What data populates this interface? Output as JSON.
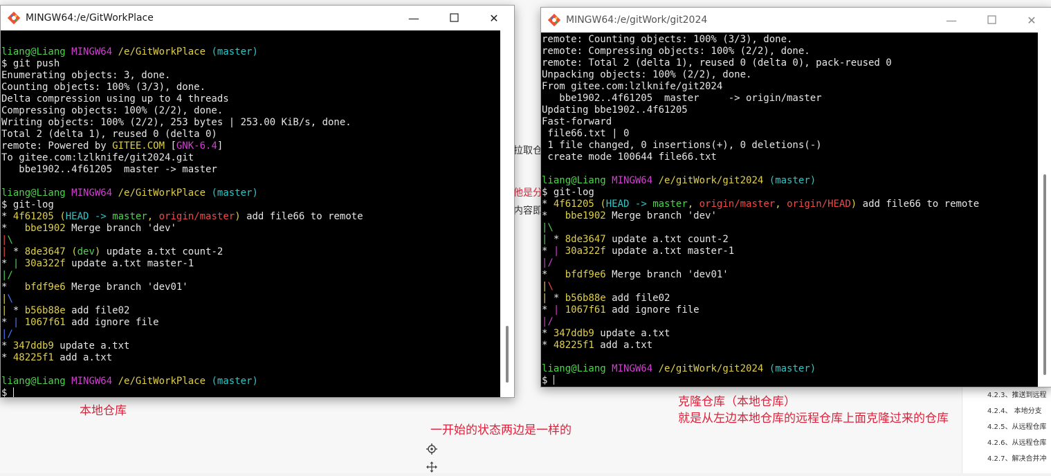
{
  "background": {
    "snippets": [
      {
        "text": "拉取仓",
        "color": "dark"
      },
      {
        "text": "他是分",
        "color": "red"
      },
      {
        "text": "内容即",
        "color": "dark"
      },
      {
        "text": "一开始的状态两边是一样的",
        "color": "red"
      }
    ],
    "toc": [
      "4.2.3、推送到远程",
      "4.2.4、 本地分支",
      "4.2.5、从远程仓库",
      "4.2.6、从远程仓库",
      "4.2.7、解决合并冲"
    ],
    "annotations": {
      "left": "本地仓库",
      "right_line1": "克隆仓库（本地仓库）",
      "right_line2": "就是从左边本地仓库的远程仓库上面克隆过来的仓库",
      "middle": "一开始的状态两边是一样的"
    }
  },
  "windows": {
    "left": {
      "title": "MINGW64:/e/GitWorkPlace",
      "lines": [
        [],
        [
          [
            "g",
            "liang@Liang"
          ],
          [
            "w",
            " "
          ],
          [
            "m",
            "MINGW64"
          ],
          [
            "w",
            " "
          ],
          [
            "y",
            "/e/GitWorkPlace"
          ],
          [
            "w",
            " "
          ],
          [
            "c",
            "(master)"
          ]
        ],
        [
          [
            "w",
            "$ git push"
          ]
        ],
        [
          [
            "w",
            "Enumerating objects: 3, done."
          ]
        ],
        [
          [
            "w",
            "Counting objects: 100% (3/3), done."
          ]
        ],
        [
          [
            "w",
            "Delta compression using up to 4 threads"
          ]
        ],
        [
          [
            "w",
            "Compressing objects: 100% (2/2), done."
          ]
        ],
        [
          [
            "w",
            "Writing objects: 100% (2/2), 253 bytes | 253.00 KiB/s, done."
          ]
        ],
        [
          [
            "w",
            "Total 2 (delta 1), reused 0 (delta 0)"
          ]
        ],
        [
          [
            "w",
            "remote: Powered by "
          ],
          [
            "y",
            "GITEE.COM"
          ],
          [
            "w",
            " ["
          ],
          [
            "m",
            "GNK-6.4"
          ],
          [
            "w",
            "]"
          ]
        ],
        [
          [
            "w",
            "To gitee.com:lzlknife/git2024.git"
          ]
        ],
        [
          [
            "w",
            "   bbe1902..4f61205  master -> master"
          ]
        ],
        [],
        [
          [
            "g",
            "liang@Liang"
          ],
          [
            "w",
            " "
          ],
          [
            "m",
            "MINGW64"
          ],
          [
            "w",
            " "
          ],
          [
            "y",
            "/e/GitWorkPlace"
          ],
          [
            "w",
            " "
          ],
          [
            "c",
            "(master)"
          ]
        ],
        [
          [
            "w",
            "$ git-log"
          ]
        ],
        [
          [
            "w",
            "* "
          ],
          [
            "y",
            "4f61205"
          ],
          [
            "w",
            " "
          ],
          [
            "y",
            "("
          ],
          [
            "c",
            "HEAD -> "
          ],
          [
            "g",
            "master"
          ],
          [
            "y",
            ", "
          ],
          [
            "r",
            "origin/master"
          ],
          [
            "y",
            ")"
          ],
          [
            "w",
            " add file66 to remote"
          ]
        ],
        [
          [
            "w",
            "*   "
          ],
          [
            "y",
            "bbe1902"
          ],
          [
            "w",
            " Merge branch 'dev'"
          ]
        ],
        [
          [
            "r",
            "|"
          ],
          [
            "g",
            "\\"
          ]
        ],
        [
          [
            "r",
            "|"
          ],
          [
            "w",
            " * "
          ],
          [
            "y",
            "8de3647"
          ],
          [
            "w",
            " "
          ],
          [
            "y",
            "("
          ],
          [
            "g",
            "dev"
          ],
          [
            "y",
            ")"
          ],
          [
            "w",
            " update a.txt count-2"
          ]
        ],
        [
          [
            "w",
            "* "
          ],
          [
            "g",
            "|"
          ],
          [
            "w",
            " "
          ],
          [
            "y",
            "30a322f"
          ],
          [
            "w",
            " update a.txt master-1"
          ]
        ],
        [
          [
            "g",
            "|/"
          ]
        ],
        [
          [
            "w",
            "*   "
          ],
          [
            "y",
            "bfdf9e6"
          ],
          [
            "w",
            " Merge branch 'dev01'"
          ]
        ],
        [
          [
            "y",
            "|"
          ],
          [
            "b",
            "\\"
          ]
        ],
        [
          [
            "y",
            "|"
          ],
          [
            "w",
            " * "
          ],
          [
            "y",
            "b56b88e"
          ],
          [
            "w",
            " add file02"
          ]
        ],
        [
          [
            "w",
            "* "
          ],
          [
            "b",
            "|"
          ],
          [
            "w",
            " "
          ],
          [
            "y",
            "1067f61"
          ],
          [
            "w",
            " add ignore file"
          ]
        ],
        [
          [
            "b",
            "|/"
          ]
        ],
        [
          [
            "w",
            "* "
          ],
          [
            "y",
            "347ddb9"
          ],
          [
            "w",
            " update a.txt"
          ]
        ],
        [
          [
            "w",
            "* "
          ],
          [
            "y",
            "48225f1"
          ],
          [
            "w",
            " add a.txt"
          ]
        ],
        [],
        [
          [
            "g",
            "liang@Liang"
          ],
          [
            "w",
            " "
          ],
          [
            "m",
            "MINGW64"
          ],
          [
            "w",
            " "
          ],
          [
            "y",
            "/e/GitWorkPlace"
          ],
          [
            "w",
            " "
          ],
          [
            "c",
            "(master)"
          ]
        ],
        [
          [
            "w",
            "$ "
          ],
          [
            "cursor",
            ""
          ]
        ]
      ]
    },
    "right": {
      "title": "MINGW64:/e/gitWork/git2024",
      "lines": [
        [
          [
            "w",
            "remote: Counting objects: 100% (3/3), done."
          ]
        ],
        [
          [
            "w",
            "remote: Compressing objects: 100% (2/2), done."
          ]
        ],
        [
          [
            "w",
            "remote: Total 2 (delta 1), reused 0 (delta 0), pack-reused 0"
          ]
        ],
        [
          [
            "w",
            "Unpacking objects: 100% (2/2), done."
          ]
        ],
        [
          [
            "w",
            "From gitee.com:lzlknife/git2024"
          ]
        ],
        [
          [
            "w",
            "   bbe1902..4f61205  master     -> origin/master"
          ]
        ],
        [
          [
            "w",
            "Updating bbe1902..4f61205"
          ]
        ],
        [
          [
            "w",
            "Fast-forward"
          ]
        ],
        [
          [
            "w",
            " file66.txt | 0"
          ]
        ],
        [
          [
            "w",
            " 1 file changed, 0 insertions(+), 0 deletions(-)"
          ]
        ],
        [
          [
            "w",
            " create mode 100644 file66.txt"
          ]
        ],
        [],
        [
          [
            "g",
            "liang@Liang"
          ],
          [
            "w",
            " "
          ],
          [
            "m",
            "MINGW64"
          ],
          [
            "w",
            " "
          ],
          [
            "y",
            "/e/gitWork/git2024"
          ],
          [
            "w",
            " "
          ],
          [
            "c",
            "(master)"
          ]
        ],
        [
          [
            "w",
            "$ git-log"
          ]
        ],
        [
          [
            "w",
            "* "
          ],
          [
            "y",
            "4f61205"
          ],
          [
            "w",
            " "
          ],
          [
            "y",
            "("
          ],
          [
            "c",
            "HEAD -> "
          ],
          [
            "g",
            "master"
          ],
          [
            "y",
            ", "
          ],
          [
            "r",
            "origin/master"
          ],
          [
            "y",
            ", "
          ],
          [
            "r",
            "origin/HEAD"
          ],
          [
            "y",
            ")"
          ],
          [
            "w",
            " add file66 to remote"
          ]
        ],
        [
          [
            "w",
            "*   "
          ],
          [
            "y",
            "bbe1902"
          ],
          [
            "w",
            " Merge branch 'dev'"
          ]
        ],
        [
          [
            "g",
            "|\\"
          ]
        ],
        [
          [
            "g",
            "|"
          ],
          [
            "w",
            " * "
          ],
          [
            "y",
            "8de3647"
          ],
          [
            "w",
            " update a.txt count-2"
          ]
        ],
        [
          [
            "w",
            "* "
          ],
          [
            "m",
            "|"
          ],
          [
            "w",
            " "
          ],
          [
            "y",
            "30a322f"
          ],
          [
            "w",
            " update a.txt master-1"
          ]
        ],
        [
          [
            "m",
            "|/"
          ]
        ],
        [
          [
            "w",
            "*   "
          ],
          [
            "y",
            "bfdf9e6"
          ],
          [
            "w",
            " Merge branch 'dev01'"
          ]
        ],
        [
          [
            "y",
            "|"
          ],
          [
            "r",
            "\\"
          ]
        ],
        [
          [
            "y",
            "|"
          ],
          [
            "w",
            " * "
          ],
          [
            "y",
            "b56b88e"
          ],
          [
            "w",
            " add file02"
          ]
        ],
        [
          [
            "w",
            "* "
          ],
          [
            "m",
            "|"
          ],
          [
            "w",
            " "
          ],
          [
            "y",
            "1067f61"
          ],
          [
            "w",
            " add ignore file"
          ]
        ],
        [
          [
            "m",
            "|/"
          ]
        ],
        [
          [
            "w",
            "* "
          ],
          [
            "y",
            "347ddb9"
          ],
          [
            "w",
            " update a.txt"
          ]
        ],
        [
          [
            "w",
            "* "
          ],
          [
            "y",
            "48225f1"
          ],
          [
            "w",
            " add a.txt"
          ]
        ],
        [],
        [
          [
            "g",
            "liang@Liang"
          ],
          [
            "w",
            " "
          ],
          [
            "m",
            "MINGW64"
          ],
          [
            "w",
            " "
          ],
          [
            "y",
            "/e/gitWork/git2024"
          ],
          [
            "w",
            " "
          ],
          [
            "c",
            "(master)"
          ]
        ],
        [
          [
            "w",
            "$ "
          ],
          [
            "cursor",
            ""
          ]
        ]
      ]
    }
  },
  "icons": {
    "app": "git-bash-icon",
    "minimize": "minimize-icon",
    "maximize": "maximize-icon",
    "close": "close-icon",
    "target": "crosshair-icon",
    "move": "move-icon"
  }
}
